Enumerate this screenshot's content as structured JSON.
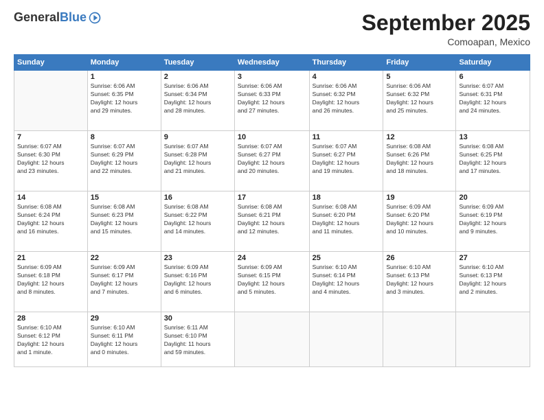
{
  "logo": {
    "general": "General",
    "blue": "Blue"
  },
  "header": {
    "month": "September 2025",
    "location": "Comoapan, Mexico"
  },
  "days_of_week": [
    "Sunday",
    "Monday",
    "Tuesday",
    "Wednesday",
    "Thursday",
    "Friday",
    "Saturday"
  ],
  "weeks": [
    [
      {
        "day": "",
        "info": ""
      },
      {
        "day": "1",
        "info": "Sunrise: 6:06 AM\nSunset: 6:35 PM\nDaylight: 12 hours\nand 29 minutes."
      },
      {
        "day": "2",
        "info": "Sunrise: 6:06 AM\nSunset: 6:34 PM\nDaylight: 12 hours\nand 28 minutes."
      },
      {
        "day": "3",
        "info": "Sunrise: 6:06 AM\nSunset: 6:33 PM\nDaylight: 12 hours\nand 27 minutes."
      },
      {
        "day": "4",
        "info": "Sunrise: 6:06 AM\nSunset: 6:32 PM\nDaylight: 12 hours\nand 26 minutes."
      },
      {
        "day": "5",
        "info": "Sunrise: 6:06 AM\nSunset: 6:32 PM\nDaylight: 12 hours\nand 25 minutes."
      },
      {
        "day": "6",
        "info": "Sunrise: 6:07 AM\nSunset: 6:31 PM\nDaylight: 12 hours\nand 24 minutes."
      }
    ],
    [
      {
        "day": "7",
        "info": "Sunrise: 6:07 AM\nSunset: 6:30 PM\nDaylight: 12 hours\nand 23 minutes."
      },
      {
        "day": "8",
        "info": "Sunrise: 6:07 AM\nSunset: 6:29 PM\nDaylight: 12 hours\nand 22 minutes."
      },
      {
        "day": "9",
        "info": "Sunrise: 6:07 AM\nSunset: 6:28 PM\nDaylight: 12 hours\nand 21 minutes."
      },
      {
        "day": "10",
        "info": "Sunrise: 6:07 AM\nSunset: 6:27 PM\nDaylight: 12 hours\nand 20 minutes."
      },
      {
        "day": "11",
        "info": "Sunrise: 6:07 AM\nSunset: 6:27 PM\nDaylight: 12 hours\nand 19 minutes."
      },
      {
        "day": "12",
        "info": "Sunrise: 6:08 AM\nSunset: 6:26 PM\nDaylight: 12 hours\nand 18 minutes."
      },
      {
        "day": "13",
        "info": "Sunrise: 6:08 AM\nSunset: 6:25 PM\nDaylight: 12 hours\nand 17 minutes."
      }
    ],
    [
      {
        "day": "14",
        "info": "Sunrise: 6:08 AM\nSunset: 6:24 PM\nDaylight: 12 hours\nand 16 minutes."
      },
      {
        "day": "15",
        "info": "Sunrise: 6:08 AM\nSunset: 6:23 PM\nDaylight: 12 hours\nand 15 minutes."
      },
      {
        "day": "16",
        "info": "Sunrise: 6:08 AM\nSunset: 6:22 PM\nDaylight: 12 hours\nand 14 minutes."
      },
      {
        "day": "17",
        "info": "Sunrise: 6:08 AM\nSunset: 6:21 PM\nDaylight: 12 hours\nand 12 minutes."
      },
      {
        "day": "18",
        "info": "Sunrise: 6:08 AM\nSunset: 6:20 PM\nDaylight: 12 hours\nand 11 minutes."
      },
      {
        "day": "19",
        "info": "Sunrise: 6:09 AM\nSunset: 6:20 PM\nDaylight: 12 hours\nand 10 minutes."
      },
      {
        "day": "20",
        "info": "Sunrise: 6:09 AM\nSunset: 6:19 PM\nDaylight: 12 hours\nand 9 minutes."
      }
    ],
    [
      {
        "day": "21",
        "info": "Sunrise: 6:09 AM\nSunset: 6:18 PM\nDaylight: 12 hours\nand 8 minutes."
      },
      {
        "day": "22",
        "info": "Sunrise: 6:09 AM\nSunset: 6:17 PM\nDaylight: 12 hours\nand 7 minutes."
      },
      {
        "day": "23",
        "info": "Sunrise: 6:09 AM\nSunset: 6:16 PM\nDaylight: 12 hours\nand 6 minutes."
      },
      {
        "day": "24",
        "info": "Sunrise: 6:09 AM\nSunset: 6:15 PM\nDaylight: 12 hours\nand 5 minutes."
      },
      {
        "day": "25",
        "info": "Sunrise: 6:10 AM\nSunset: 6:14 PM\nDaylight: 12 hours\nand 4 minutes."
      },
      {
        "day": "26",
        "info": "Sunrise: 6:10 AM\nSunset: 6:13 PM\nDaylight: 12 hours\nand 3 minutes."
      },
      {
        "day": "27",
        "info": "Sunrise: 6:10 AM\nSunset: 6:13 PM\nDaylight: 12 hours\nand 2 minutes."
      }
    ],
    [
      {
        "day": "28",
        "info": "Sunrise: 6:10 AM\nSunset: 6:12 PM\nDaylight: 12 hours\nand 1 minute."
      },
      {
        "day": "29",
        "info": "Sunrise: 6:10 AM\nSunset: 6:11 PM\nDaylight: 12 hours\nand 0 minutes."
      },
      {
        "day": "30",
        "info": "Sunrise: 6:11 AM\nSunset: 6:10 PM\nDaylight: 11 hours\nand 59 minutes."
      },
      {
        "day": "",
        "info": ""
      },
      {
        "day": "",
        "info": ""
      },
      {
        "day": "",
        "info": ""
      },
      {
        "day": "",
        "info": ""
      }
    ]
  ]
}
